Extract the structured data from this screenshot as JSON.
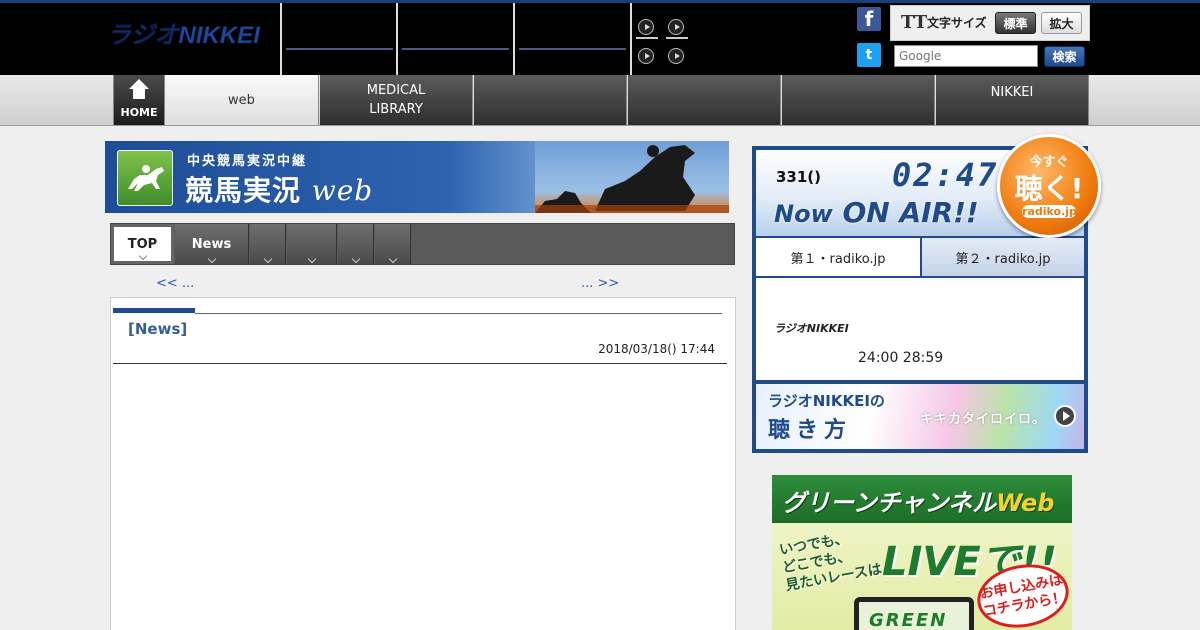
{
  "header": {
    "logo_text": "ラジオNIKKEI",
    "facebook_icon": "f",
    "twitter_icon": "t",
    "font_size": {
      "icon_text": "TT",
      "label": "文字サイズ",
      "standard_label": "標準",
      "large_label": "拡大"
    },
    "search": {
      "placeholder": "Google",
      "button_label": "検索"
    }
  },
  "gnav": {
    "home_label": "HOME",
    "items": [
      "web",
      "MEDICAL LIBRARY",
      "",
      "",
      "",
      "NIKKEI"
    ]
  },
  "banner": {
    "subtitle": "中央競馬実況中継",
    "title": "競馬実況",
    "title_suffix": "web"
  },
  "subnav": {
    "tabs": [
      "TOP",
      "News",
      "",
      "",
      "",
      ""
    ]
  },
  "pager": {
    "prev": "<< ...",
    "next": "... >>"
  },
  "article": {
    "title": "[News]",
    "date": "2018/03/18() 17:44"
  },
  "onair": {
    "time_label": "331()",
    "clock": "02:47",
    "now_label": "Now",
    "onair_label": "ON AIR!!",
    "listen_small": "今すぐ",
    "listen_big": "聴く!",
    "listen_radiko": "radiko.jp",
    "channel1": "第１・radiko.jp",
    "channel2": "第２・radiko.jp",
    "program_logo": "ラジオNIKKEI",
    "program_hours": "24:00  28:59",
    "howto_line1": "ラジオNIKKEIの",
    "howto_line2": "聴き方",
    "howto_right": "キキカタイロイロ。"
  },
  "greenchannel": {
    "title": "グリーンチャンネル",
    "title_suffix": "Web",
    "text_lines": [
      "いつでも、",
      "どこでも、",
      "見たいレースは"
    ],
    "live": "LIVEで!!",
    "apply_lines": [
      "お申し込みは",
      "コチラから！"
    ],
    "tv_label": "GREEN"
  },
  "colors": {
    "brand_blue": "#1f4a8c",
    "header_bg": "#000000",
    "accent_orange": "#f07a0e",
    "green": "#2e8d3b"
  }
}
